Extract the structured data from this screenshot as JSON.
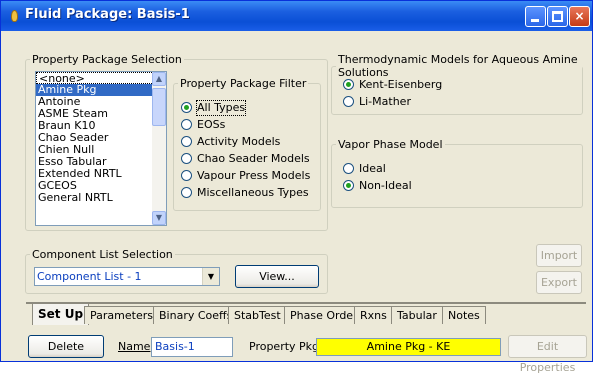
{
  "window": {
    "title": "Fluid Package: Basis-1",
    "buttons": {
      "minimize": "minimize-icon",
      "maximize": "maximize-icon",
      "close": "×"
    }
  },
  "property_package_selection": {
    "legend": "Property Package Selection",
    "items": [
      "<none>",
      "Amine Pkg",
      "Antoine",
      "ASME Steam",
      "Braun K10",
      "Chao Seader",
      "Chien Null",
      "Esso Tabular",
      "Extended NRTL",
      "GCEOS",
      "General NRTL"
    ],
    "selected": "Amine Pkg"
  },
  "property_package_filter": {
    "legend": "Property Package Filter",
    "options": [
      "All Types",
      "EOSs",
      "Activity Models",
      "Chao Seader Models",
      "Vapour Press Models",
      "Miscellaneous Types"
    ],
    "selected": "All Types"
  },
  "thermo_models": {
    "legend": "Thermodynamic Models for Aqueous Amine Solutions",
    "options": [
      "Kent-Eisenberg",
      "Li-Mather"
    ],
    "selected": "Kent-Eisenberg"
  },
  "vapour_phase": {
    "legend": "Vapor Phase Model",
    "options": [
      "Ideal",
      "Non-Ideal"
    ],
    "selected": "Non-Ideal"
  },
  "component_list": {
    "legend": "Component List Selection",
    "value": "Component List - 1",
    "view_label": "View..."
  },
  "side_buttons": {
    "import": "Import",
    "export": "Export"
  },
  "tabs": [
    "Set Up",
    "Parameters",
    "Binary Coeffs",
    "StabTest",
    "Phase Order",
    "Rxns",
    "Tabular",
    "Notes"
  ],
  "active_tab": "Set Up",
  "bottom": {
    "delete_label": "Delete",
    "name_label": "Name",
    "name_value": "Basis-1",
    "property_pkg_label": "Property Pkg",
    "property_pkg_value": "Amine Pkg - KE",
    "edit_properties_label": "Edit Properties",
    "highlight_color": "#ffff00"
  }
}
